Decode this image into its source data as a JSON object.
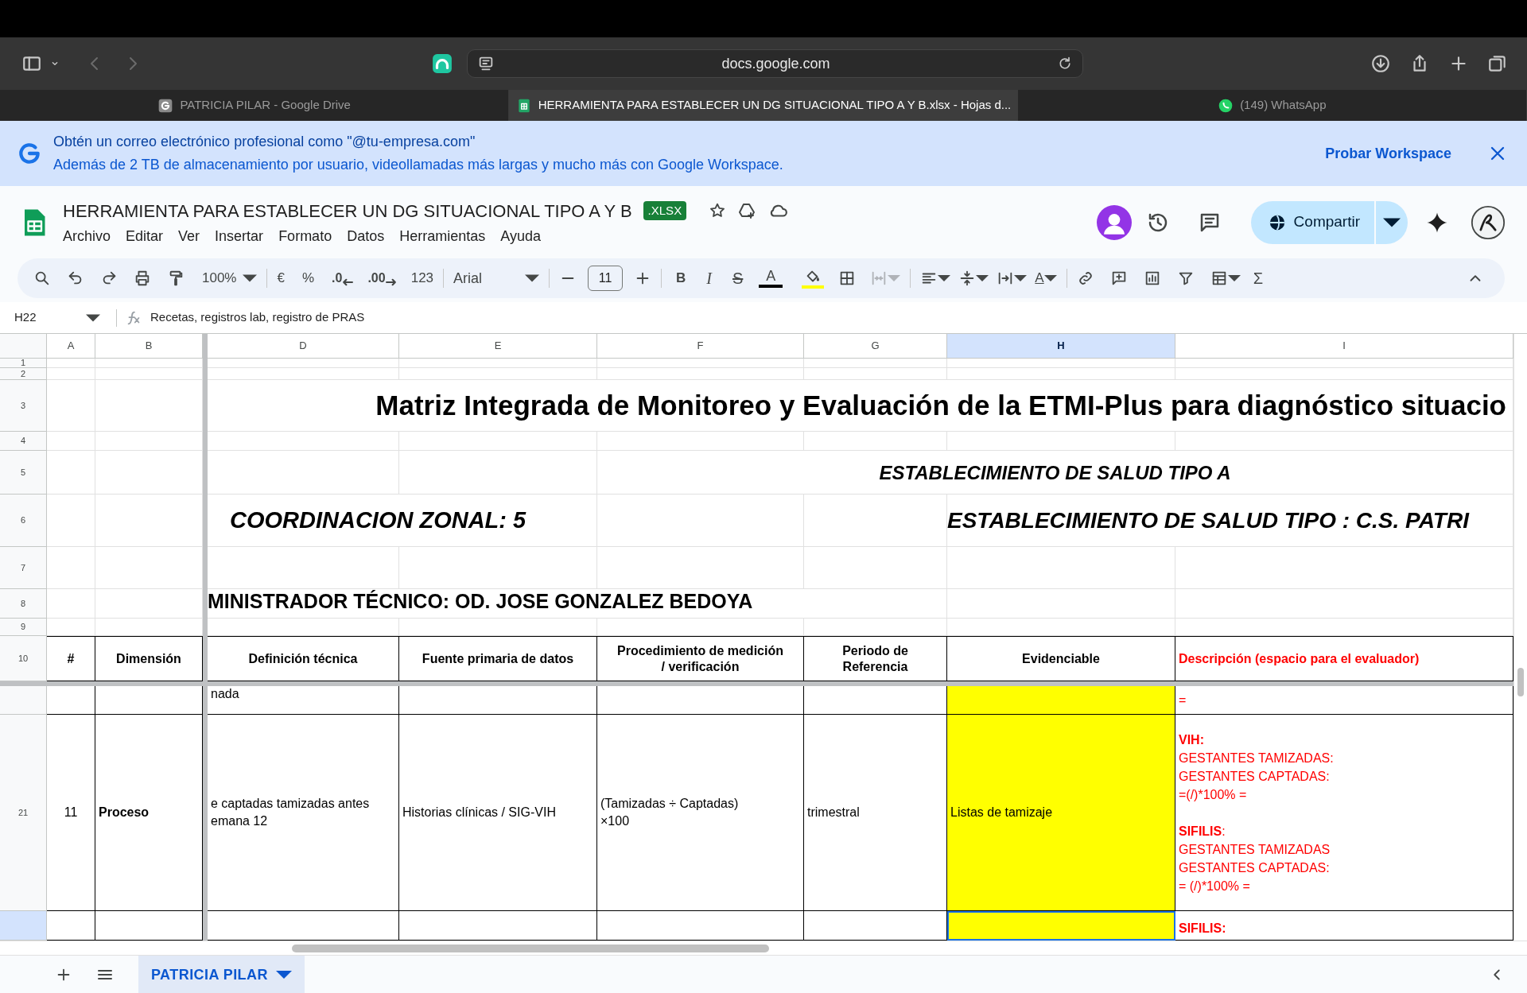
{
  "browser": {
    "address": "docs.google.com",
    "tabs": [
      {
        "label": "PATRICIA PILAR - Google Drive",
        "kind": "drive",
        "selected": false
      },
      {
        "label": "HERRAMIENTA PARA ESTABLECER UN DG SITUACIONAL TIPO A Y B.xlsx - Hojas d...",
        "kind": "sheets",
        "selected": true
      },
      {
        "label": "(149) WhatsApp",
        "kind": "whatsapp",
        "selected": false
      }
    ]
  },
  "banner": {
    "title": "Obtén un correo electrónico profesional como \"@tu-empresa.com\"",
    "text": "Además de 2 TB de almacenamiento por usuario, videollamadas más largas y mucho más con Google Workspace.",
    "action": "Probar Workspace"
  },
  "document": {
    "title": "HERRAMIENTA PARA ESTABLECER UN DG SITUACIONAL TIPO A Y B",
    "badge": ".XLSX",
    "menu": [
      "Archivo",
      "Editar",
      "Ver",
      "Insertar",
      "Formato",
      "Datos",
      "Herramientas",
      "Ayuda"
    ],
    "share": "Compartir"
  },
  "toolbar": {
    "zoom": "100%",
    "currency": "€",
    "percent": "%",
    "decrease_decimals": ".0",
    "increase_decimals": ".00",
    "number_format": "123",
    "font": "Arial",
    "font_size": "11",
    "bold": "B",
    "italic": "I",
    "strikethrough": "S",
    "text_color": "A",
    "text_rotation": "A",
    "functions": "Σ"
  },
  "formula_bar": {
    "cell": "H22",
    "content": "Recetas, registros lab, registro de PRAS"
  },
  "sheet": {
    "columns": [
      {
        "label": "A",
        "selected": false
      },
      {
        "label": "B",
        "selected": false
      },
      {
        "label": "D",
        "selected": false
      },
      {
        "label": "E",
        "selected": false
      },
      {
        "label": "F",
        "selected": false
      },
      {
        "label": "G",
        "selected": false
      },
      {
        "label": "H",
        "selected": true
      },
      {
        "label": "I",
        "selected": false
      }
    ],
    "frozen_rows": [
      {
        "number": "1",
        "kind": "plain",
        "selected": false
      },
      {
        "number": "2",
        "kind": "plain",
        "selected": false
      },
      {
        "number": "3",
        "kind": "plain",
        "selected": false,
        "cells": [
          null,
          null,
          {
            "kind": "title",
            "text": "Matriz Integrada de Monitoreo y Evaluación de la ETMI-Plus para diagnóstico situacio"
          },
          {
            "kind": "merged"
          },
          {
            "kind": "merged"
          },
          {
            "kind": "merged"
          },
          {
            "kind": "merged"
          },
          {
            "kind": "merged"
          }
        ]
      },
      {
        "number": "4",
        "kind": "plain",
        "selected": false
      },
      {
        "number": "5",
        "kind": "plain",
        "selected": false,
        "cells": [
          null,
          null,
          null,
          null,
          {
            "kind": "heading_center",
            "text": "ESTABLECIMIENTO DE SALUD TIPO A"
          },
          {
            "kind": "merged"
          },
          {
            "kind": "merged"
          },
          {
            "kind": "merged"
          }
        ]
      },
      {
        "number": "6",
        "kind": "plain",
        "selected": false,
        "cells": [
          null,
          null,
          {
            "kind": "heading_indent",
            "text": "COORDINACION ZONAL: 5"
          },
          {
            "kind": "merged"
          },
          null,
          null,
          {
            "kind": "heading_left",
            "text": "ESTABLECIMIENTO DE SALUD TIPO :  C.S. PATRI"
          },
          {
            "kind": "merged"
          }
        ]
      },
      {
        "number": "7",
        "kind": "plain",
        "selected": false
      },
      {
        "number": "8",
        "kind": "plain",
        "selected": false,
        "cells": [
          null,
          null,
          {
            "kind": "heading_plain",
            "text": "MINISTRADOR TÉCNICO: OD. JOSE GONZALEZ BEDOYA"
          },
          {
            "kind": "merged"
          },
          {
            "kind": "merged"
          },
          {
            "kind": "merged"
          },
          null,
          null
        ]
      },
      {
        "number": "9",
        "kind": "plain",
        "selected": false
      },
      {
        "number": "10",
        "kind": "table",
        "selected": false,
        "cells": [
          {
            "kind": "header",
            "text": "#"
          },
          {
            "kind": "header",
            "text": "Dimensión"
          },
          {
            "kind": "header",
            "text": "Definición técnica"
          },
          {
            "kind": "header",
            "text": "Fuente primaria de datos"
          },
          {
            "kind": "header",
            "text": "Procedimiento de medición\n/ verificación"
          },
          {
            "kind": "header",
            "text": "Periodo de\nReferencia"
          },
          {
            "kind": "header",
            "text": "Evidenciable"
          },
          {
            "kind": "header_red",
            "text": "Descripción (espacio para el evaluador)"
          }
        ]
      }
    ],
    "rows": [
      {
        "kind": "table",
        "selected": false,
        "cells": [
          null,
          null,
          {
            "kind": "top",
            "text": "nada"
          },
          null,
          null,
          null,
          {
            "kind": "highlight"
          },
          {
            "kind": "red_top",
            "text": "="
          }
        ]
      },
      {
        "number": "21",
        "kind": "table",
        "selected": false,
        "cells": [
          {
            "kind": "number",
            "text": "11"
          },
          {
            "kind": "bold",
            "text": "Proceso"
          },
          {
            "kind": "plain",
            "text": "e captadas tamizadas antes\nemana 12"
          },
          {
            "kind": "plain",
            "text": "Historias clínicas / SIG-VIH"
          },
          {
            "kind": "plain",
            "text": "(Tamizadas ÷ Captadas)\n×100"
          },
          {
            "kind": "plain",
            "text": "trimestral"
          },
          {
            "kind": "highlight",
            "text": "Listas de tamizaje"
          },
          {
            "kind": "red_note",
            "text": "**VIH:**\nGESTANTES TAMIZADAS:\nGESTANTES CAPTADAS:\n=(/)*100% =\n\n**SIFILIS**:\nGESTANTES TAMIZADAS\nGESTANTES CAPTADAS:\n= (/)*100% ="
          }
        ]
      },
      {
        "kind": "table",
        "selected": true,
        "cells": [
          null,
          null,
          null,
          null,
          null,
          null,
          {
            "kind": "highlight"
          },
          {
            "kind": "red_bold_top",
            "text": "SIFILIS:"
          }
        ]
      }
    ]
  },
  "sheet_tabs": [
    {
      "label": "PATRICIA PILAR",
      "selected": true
    }
  ]
}
